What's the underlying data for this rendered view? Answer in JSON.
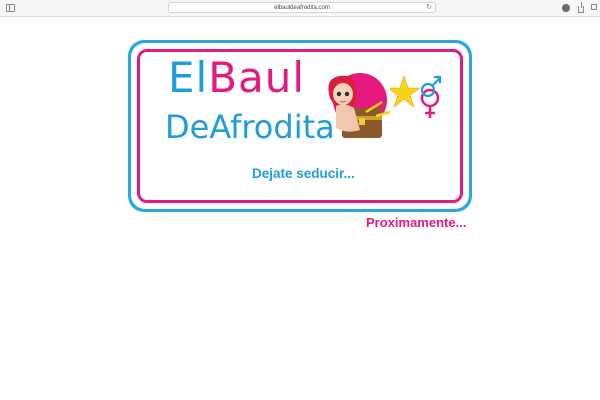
{
  "browser": {
    "url": "elbauldeafrodita.com",
    "reload_glyph": "↻",
    "icons": [
      "sidebar-icon",
      "reload-icon",
      "extension-icon",
      "share-icon",
      "tabs-icon"
    ]
  },
  "logo": {
    "word_el": "El",
    "word_baul": "Baul",
    "line2": "DeAfrodita",
    "mascot": "cartoon-girl-treasure-chest",
    "emblem": "star-gender-symbols"
  },
  "tagline": "Dejate seducir...",
  "coming_soon": "Proximamente...",
  "colors": {
    "pink": "#e6197f",
    "blue": "#1e9ddb",
    "frame_blue": "#2aa9e0",
    "star_yellow": "#f7d417"
  }
}
